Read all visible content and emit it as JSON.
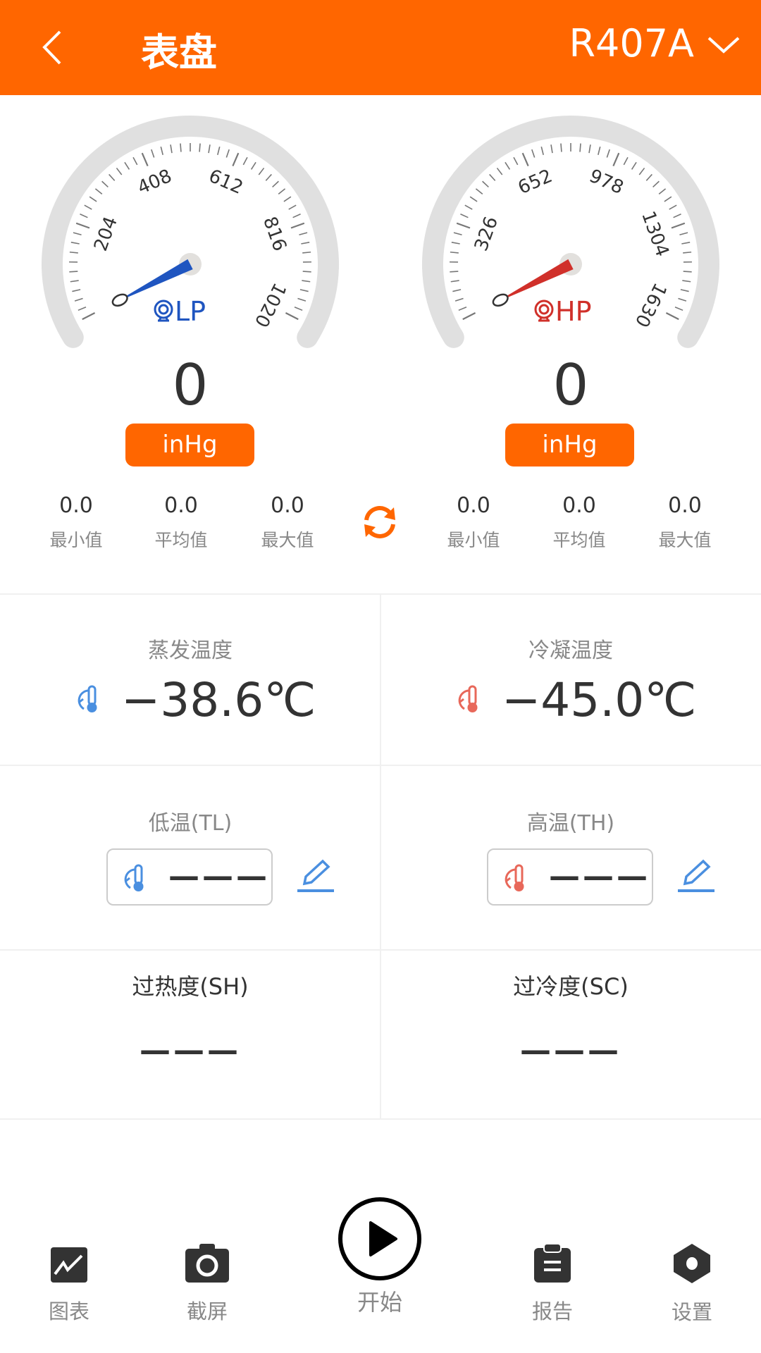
{
  "header": {
    "title": "表盘",
    "refrigerant": "R407A",
    "back_icon": "chevron-left-icon",
    "dropdown_icon": "chevron-down-icon",
    "color": "#FF6600"
  },
  "gauges": [
    {
      "name": "LP",
      "value": "0",
      "unit": "inHg",
      "min": 0,
      "max": 1020,
      "ticks": [
        "204",
        "408",
        "612",
        "816",
        "1020"
      ],
      "needle_value": 0,
      "color": "#1f55c0",
      "icon": "sensor-icon",
      "stats": [
        {
          "value": "0.0",
          "label": "最小值"
        },
        {
          "value": "0.0",
          "label": "平均值"
        },
        {
          "value": "0.0",
          "label": "最大值"
        }
      ]
    },
    {
      "name": "HP",
      "value": "0",
      "unit": "inHg",
      "min": 0,
      "max": 1630,
      "ticks": [
        "326",
        "652",
        "978",
        "1304",
        "1630"
      ],
      "needle_value": 0,
      "color": "#d0302a",
      "icon": "sensor-icon",
      "stats": [
        {
          "value": "0.0",
          "label": "最小值"
        },
        {
          "value": "0.0",
          "label": "平均值"
        },
        {
          "value": "0.0",
          "label": "最大值"
        }
      ]
    }
  ],
  "refresh_icon": "refresh-icon",
  "evap": {
    "label": "蒸发温度",
    "value": "−38.6℃"
  },
  "cond": {
    "label": "冷凝温度",
    "value": "−45.0℃"
  },
  "tl": {
    "label": "低温(TL)",
    "value": "———"
  },
  "th": {
    "label": "高温(TH)",
    "value": "———"
  },
  "sh": {
    "label": "过热度(SH)",
    "value": "———"
  },
  "sc": {
    "label": "过冷度(SC)",
    "value": "———"
  },
  "nav": [
    {
      "label": "图表",
      "icon": "chart-icon"
    },
    {
      "label": "截屏",
      "icon": "camera-icon"
    },
    {
      "label": "开始",
      "icon": "play-icon"
    },
    {
      "label": "报告",
      "icon": "clipboard-icon"
    },
    {
      "label": "设置",
      "icon": "settings-icon"
    }
  ]
}
